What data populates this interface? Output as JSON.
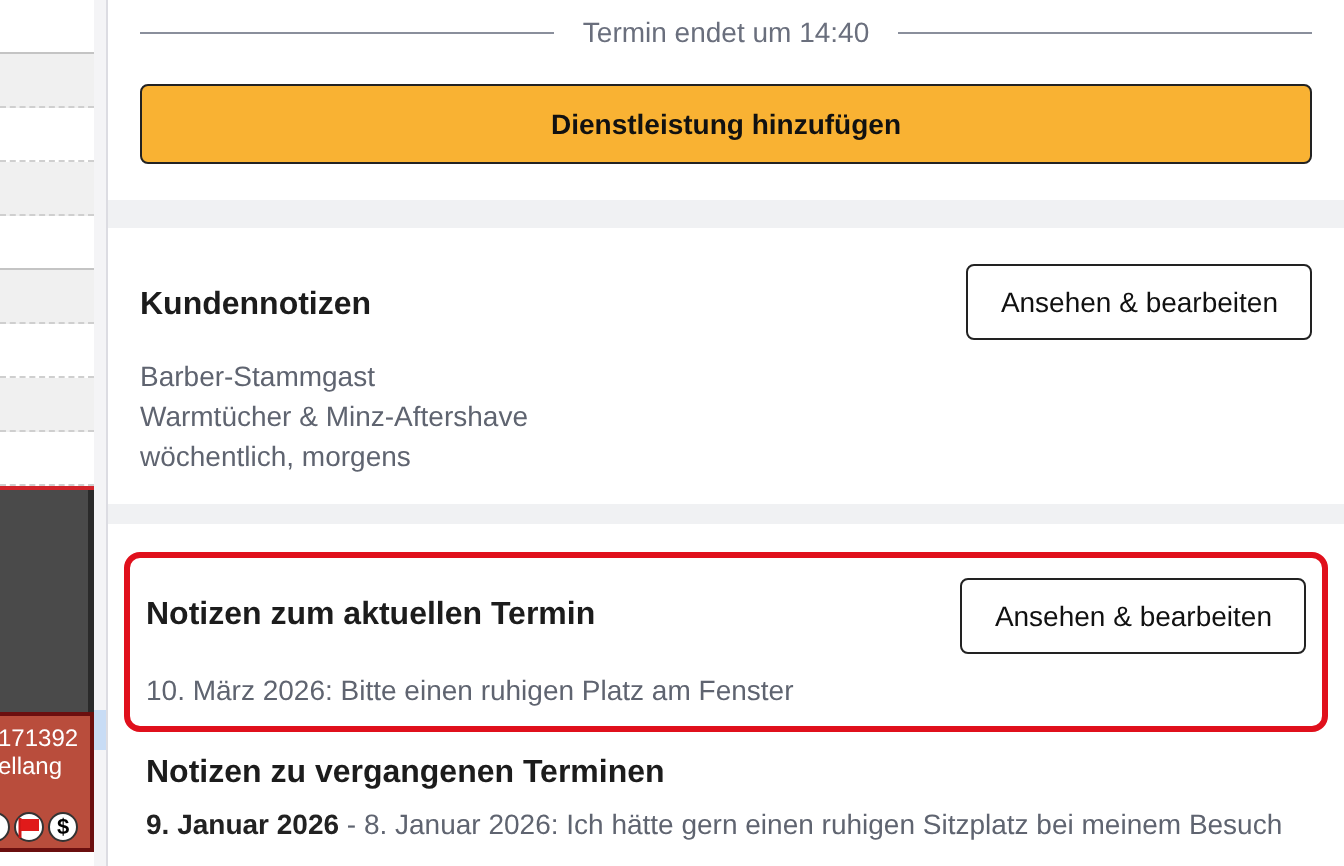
{
  "calendar": {
    "event": {
      "lines": [
        "171392",
        "ellang"
      ],
      "badges": [
        {
          "kind": "partial"
        },
        {
          "kind": "flag"
        },
        {
          "kind": "dollar",
          "text": "$"
        }
      ]
    }
  },
  "end_divider": "Termin endet um 14:40",
  "add_service_button": "Dienstleistung hinzufügen",
  "customer_notes": {
    "title": "Kundennotizen",
    "button": "Ansehen & bearbeiten",
    "lines": [
      "Barber-Stammgast",
      "Warmtücher & Minz-Aftershave",
      "wöchentlich, morgens"
    ]
  },
  "current_notes": {
    "title": "Notizen zum aktuellen Termin",
    "button": "Ansehen & bearbeiten",
    "highlighted": true,
    "text": "10. März 2026: Bitte einen ruhigen Platz am Fenster"
  },
  "past_notes": {
    "title": "Notizen zu vergangenen Terminen",
    "entries": [
      {
        "text": "**9. Januar 2026** -  8. Januar 2026: Ich hätte gern einen ruhigen Sitzplatz bei meinem Besuch"
      }
    ]
  }
}
